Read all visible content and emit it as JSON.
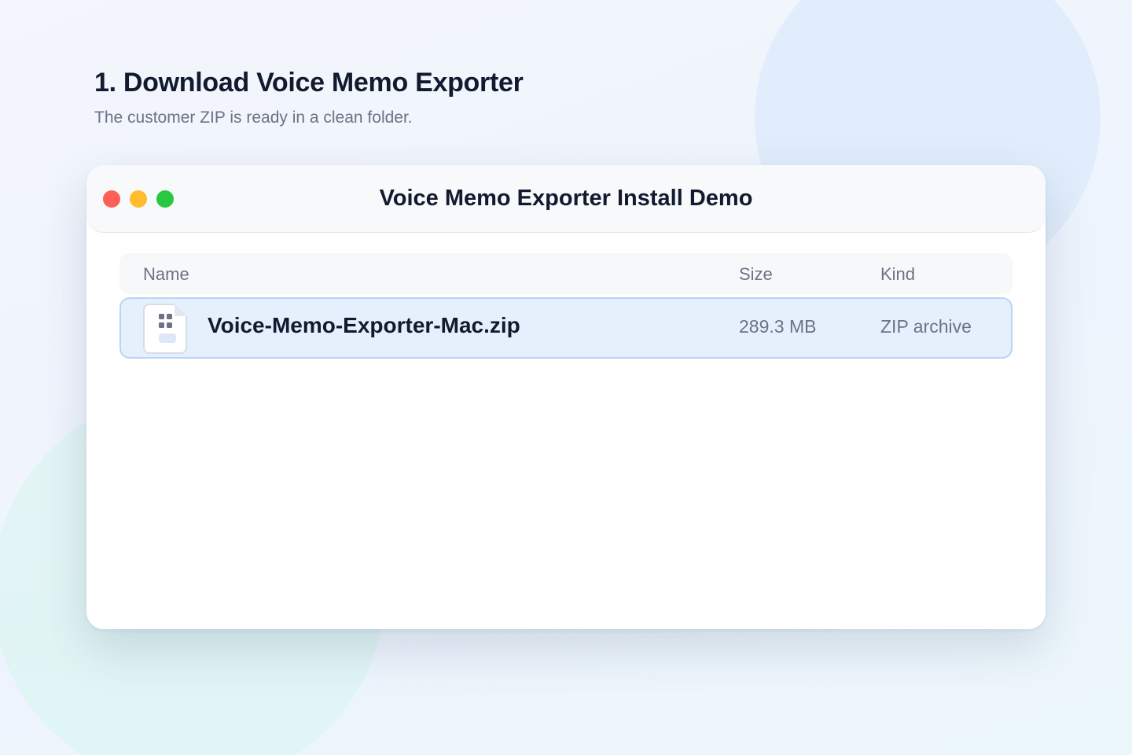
{
  "page": {
    "heading": "1. Download Voice Memo Exporter",
    "subheading": "The customer ZIP is ready in a clean folder."
  },
  "window": {
    "title": "Voice Memo Exporter Install Demo",
    "controls": [
      "close",
      "minimize",
      "zoom"
    ]
  },
  "list": {
    "columns": {
      "name": "Name",
      "size": "Size",
      "kind": "Kind"
    },
    "rows": [
      {
        "name": "Voice-Memo-Exporter-Mac.zip",
        "size": "289.3 MB",
        "kind": "ZIP archive",
        "icon": "zip-file-icon",
        "selected": true
      }
    ]
  },
  "colors": {
    "close": "#fe5f57",
    "minimize": "#febc2e",
    "zoom": "#28c840",
    "selection_bg": "#e6f0fd",
    "selection_border": "#b8d4f6"
  }
}
